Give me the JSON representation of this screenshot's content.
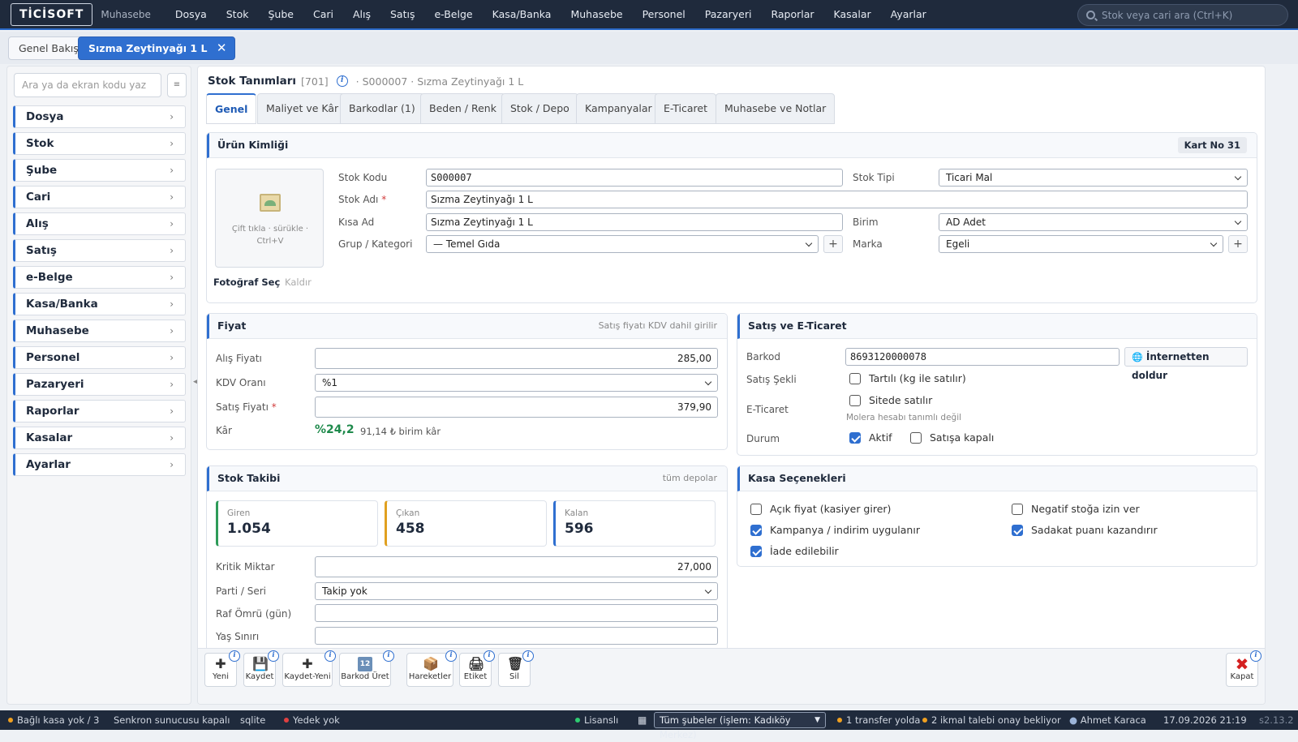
{
  "app": {
    "logo": "TİCİSOFT",
    "module": "Muhasebe"
  },
  "nav": [
    "Dosya",
    "Stok",
    "Şube",
    "Cari",
    "Alış",
    "Satış",
    "e-Belge",
    "Kasa/Banka",
    "Muhasebe",
    "Personel",
    "Pazaryeri",
    "Raporlar",
    "Kasalar",
    "Ayarlar"
  ],
  "top_search": {
    "placeholder": "Stok veya cari ara (Ctrl+K)"
  },
  "doc_tabs": {
    "overview": "Genel Bakış",
    "active": "Sızma Zeytinyağı 1 L",
    "close": "✕"
  },
  "sidebar": {
    "search_placeholder": "Ara ya da ekran kodu yaz",
    "menu_icon": "≡",
    "items": [
      "Dosya",
      "Stok",
      "Şube",
      "Cari",
      "Alış",
      "Satış",
      "e-Belge",
      "Kasa/Banka",
      "Muhasebe",
      "Personel",
      "Pazaryeri",
      "Raporlar",
      "Kasalar",
      "Ayarlar"
    ],
    "chevron": "›",
    "collapse": "◀"
  },
  "page": {
    "title": "Stok Tanımları",
    "code": "[701]",
    "crumb": "· S000007 · Sızma Zeytinyağı 1 L",
    "info": "i"
  },
  "tabs": [
    "Genel",
    "Maliyet ve Kâr",
    "Barkodlar (1)",
    "Beden / Renk",
    "Stok / Depo",
    "Kampanyalar",
    "E-Ticaret",
    "Muhasebe ve Notlar"
  ],
  "identity": {
    "title": "Ürün Kimliği",
    "card_no": "Kart No 31",
    "photo_hint": "Çift tıkla · sürükle · Ctrl+V",
    "photo_select": "Fotoğraf Seç",
    "photo_remove": "Kaldır",
    "stock_code_label": "Stok Kodu",
    "stock_code": "S000007",
    "stock_name_label": "Stok Adı",
    "stock_name": "Sızma Zeytinyağı 1 L",
    "short_name_label": "Kısa Ad",
    "short_name": "Sızma Zeytinyağı 1 L",
    "group_label": "Grup / Kategori",
    "group": "— Temel Gıda",
    "type_label": "Stok Tipi",
    "type": "Ticari Mal",
    "unit_label": "Birim",
    "unit": "AD Adet",
    "brand_label": "Marka",
    "brand": "Egeli",
    "plus": "+",
    "required": "*"
  },
  "price": {
    "title": "Fiyat",
    "note": "Satış fiyatı KDV dahil girilir",
    "buy_label": "Alış Fiyatı",
    "buy": "285,00",
    "vat_label": "KDV Oranı",
    "vat": "%1",
    "sell_label": "Satış Fiyatı",
    "sell": "379,90",
    "profit_label": "Kâr",
    "profit_pct": "%24,2",
    "profit_unit": "91,14 ₺ birim kâr",
    "colors": {
      "profit": "#1f8a4c"
    }
  },
  "sales": {
    "title": "Satış ve E-Ticaret",
    "barcode_label": "Barkod",
    "barcode": "8693120000078",
    "fill_btn": "İnternetten doldur",
    "globe": "🌐",
    "mode_label": "Satış Şekli",
    "weighed": "Tartılı (kg ile satılır)",
    "weighed_checked": false,
    "ecom_label": "E-Ticaret",
    "on_site": "Sitede satılır",
    "on_site_checked": false,
    "ecom_note": "Molera hesabı tanımlı değil",
    "status_label": "Durum",
    "active": "Aktif",
    "active_checked": true,
    "closed": "Satışa kapalı",
    "closed_checked": false
  },
  "stock": {
    "title": "Stok Takibi",
    "note": "tüm depolar",
    "in_label": "Giren",
    "in": "1.054",
    "out_label": "Çıkan",
    "out": "458",
    "left_label": "Kalan",
    "left": "596",
    "critical_label": "Kritik Miktar",
    "critical": "27,000",
    "lot_label": "Parti / Seri",
    "lot": "Takip yok",
    "shelf_label": "Raf Ömrü (gün)",
    "shelf": "",
    "age_label": "Yaş Sınırı",
    "age": "",
    "colors": {
      "in": "#2e9b58",
      "out": "#e0a020",
      "left": "#2f6fd0"
    }
  },
  "pos": {
    "title": "Kasa Seçenekleri",
    "open_price": "Açık fiyat (kasiyer girer)",
    "open_price_checked": false,
    "campaign": "Kampanya / indirim uygulanır",
    "campaign_checked": true,
    "returnable": "İade edilebilir",
    "returnable_checked": true,
    "negative": "Negatif stoğa izin ver",
    "negative_checked": false,
    "loyalty": "Sadakat puanı kazandırır",
    "loyalty_checked": true
  },
  "toolbar": {
    "new": "Yeni",
    "save": "Kaydet",
    "save_new": "Kaydet-Yeni",
    "barcode_gen": "Barkod Üret",
    "moves": "Hareketler",
    "label": "Etiket",
    "delete": "Sil",
    "close": "Kapat",
    "icons": {
      "new": "✚",
      "save": "💾",
      "save_new": "✚",
      "barcode_gen": "12",
      "moves": "📦",
      "label": "🖨",
      "delete": "🗑",
      "close": "✖"
    },
    "info": "i"
  },
  "statusbar": {
    "register": "Bağlı kasa yok / 3",
    "sync": "Senkron sunucusu kapalı",
    "db": "sqlite",
    "backup": "Yedek yok",
    "license": "Lisanslı",
    "branch": "Tüm şubeler (işlem: Kadıköy Merkez)",
    "transfer": "1 transfer yolda",
    "supply": "2 ikmal talebi onay bekliyor",
    "user": "Ahmet Karaca",
    "datetime": "17.09.2026 21:19",
    "version": "s2.13.2",
    "colors": {
      "backup": "#e04040",
      "license": "#2ecc71",
      "transfer": "#f0a020",
      "supply": "#f0a020"
    }
  }
}
